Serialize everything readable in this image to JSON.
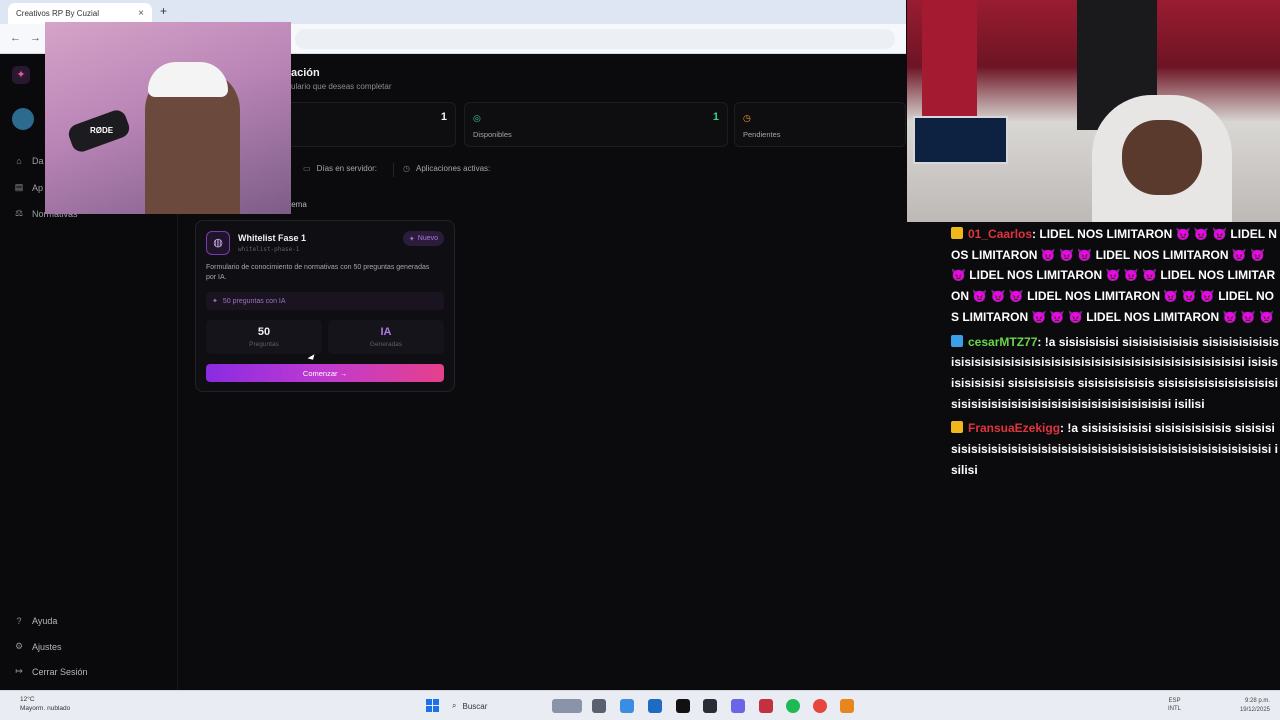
{
  "browser": {
    "tab_title": "Creativos RP By Cuzial",
    "tab_close": "×",
    "new_tab": "+",
    "back": "←",
    "forward": "→"
  },
  "app": {
    "page_title": "ación",
    "page_subtitle": "ulario que deseas completar",
    "stats": [
      {
        "value": "1",
        "label": "",
        "icon": "list-icon"
      },
      {
        "value": "1",
        "label": "Disponibles",
        "icon": "check-circle-icon"
      },
      {
        "value": "",
        "label": "Pendientes",
        "icon": "clock-icon"
      }
    ],
    "info": {
      "days_label": "Días en servidor:",
      "apps_label": "Aplicaciones activas:"
    },
    "section_label": "tema",
    "sidebar": {
      "top_items": [
        {
          "label": "Da",
          "icon": "home-icon"
        },
        {
          "label": "Ap",
          "icon": "file-icon"
        },
        {
          "label": "Normativas",
          "icon": "scale-icon"
        }
      ],
      "bottom_items": [
        {
          "label": "Ayuda",
          "icon": "help-icon"
        },
        {
          "label": "Ajustes",
          "icon": "gear-icon"
        },
        {
          "label": "Cerrar Sesión",
          "icon": "logout-icon"
        }
      ]
    },
    "card": {
      "title": "Whitelist Fase 1",
      "slug": "whitelist-phase-1",
      "badge": "Nuevo",
      "description": "Formulario de conocimiento de normativas con 50 preguntas generadas por IA.",
      "chip": "50 preguntas con IA",
      "questions_value": "50",
      "questions_label": "Preguntas",
      "generated_value": "IA",
      "generated_label": "Generadas",
      "button": "Comenzar →"
    }
  },
  "overlay": {
    "mic_text": "RØDE"
  },
  "chat": [
    {
      "user": "01_Caarlos",
      "user_color": "#e0333f",
      "badge_color": "#f2b81b",
      "text": ": LIDEL NOS LIMITARON 👿 👿 👿 LIDEL NOS LIMITARON 👿 👿 👿 LIDEL NOS LIMITARON 👿 👿 👿 LIDEL NOS LIMITARON 👿 👿 👿 LIDEL NOS LIMITARON 👿 👿 👿 LIDEL NOS LIMITARON 👿 👿 👿 LIDEL NOS LIMITARON 👿 👿 👿 LIDEL NOS LIMITARON 👿 👿 👿"
    },
    {
      "user": "cesarMTZ77",
      "user_color": "#6cd44a",
      "badge_color": "#3aa0e8",
      "text": ": !a sisisisisisi sisisisisisisis sisisisisisisisisisisisisisisisisisisisisisisisisisisisisisisisisisisisisi isisisisisisisisi sisisisisisis sisisisisisisis sisisisisisisisisisisisisisisisisisisisisisisisisisisisisisisisisisi isilisi"
    },
    {
      "user": "FransuaEzekigg",
      "user_color": "#e0333f",
      "badge_color": "#f2b81b",
      "text": ": !a sisisisisisisi sisisisisisisis sisisisisisisisisisisisisisisisisisisisisisisisisisisisisisisisisisisisi isilisi"
    }
  ],
  "taskbar": {
    "temp": "12°C",
    "weather": "Mayorm. nublado",
    "search": "Buscar",
    "lang_1": "ESP",
    "lang_2": "INTL",
    "time": "9:28 p.m.",
    "date": "19/12/2025"
  }
}
